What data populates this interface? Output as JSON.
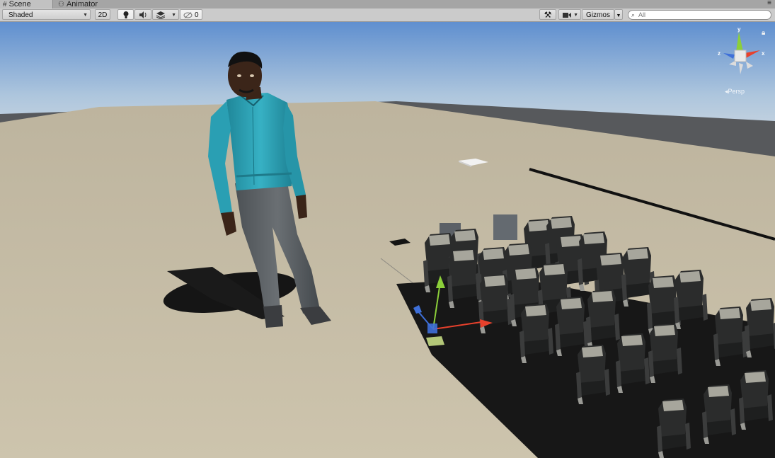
{
  "tabs": [
    {
      "label": "Scene",
      "icon": "hash-grid-icon",
      "active": true
    },
    {
      "label": "Animator",
      "icon": "animator-icon",
      "active": false
    }
  ],
  "toolbar": {
    "draw_mode": "Shaded",
    "mode_2d": "2D",
    "lighting_icon": "lightbulb-icon",
    "audio_icon": "speaker-icon",
    "effects_icon": "layers-effects-icon",
    "hidden_count": "0",
    "tools_icon": "crossed-tools-icon",
    "camera_icon": "camera-icon",
    "gizmos_label": "Gizmos",
    "search_placeholder": "All",
    "menu_icon": "panel-menu-icon"
  },
  "orientation_gizmo": {
    "projection_label": "Persp",
    "axis_y": "y",
    "axis_x": "x",
    "axis_z": "z",
    "lock_icon": "lock-icon"
  },
  "colors": {
    "x_axis": "#e8412c",
    "y_axis": "#8ccf3a",
    "z_axis": "#3e6fd8",
    "ground": "#c6bda8",
    "shirt": "#2ea0b5"
  }
}
